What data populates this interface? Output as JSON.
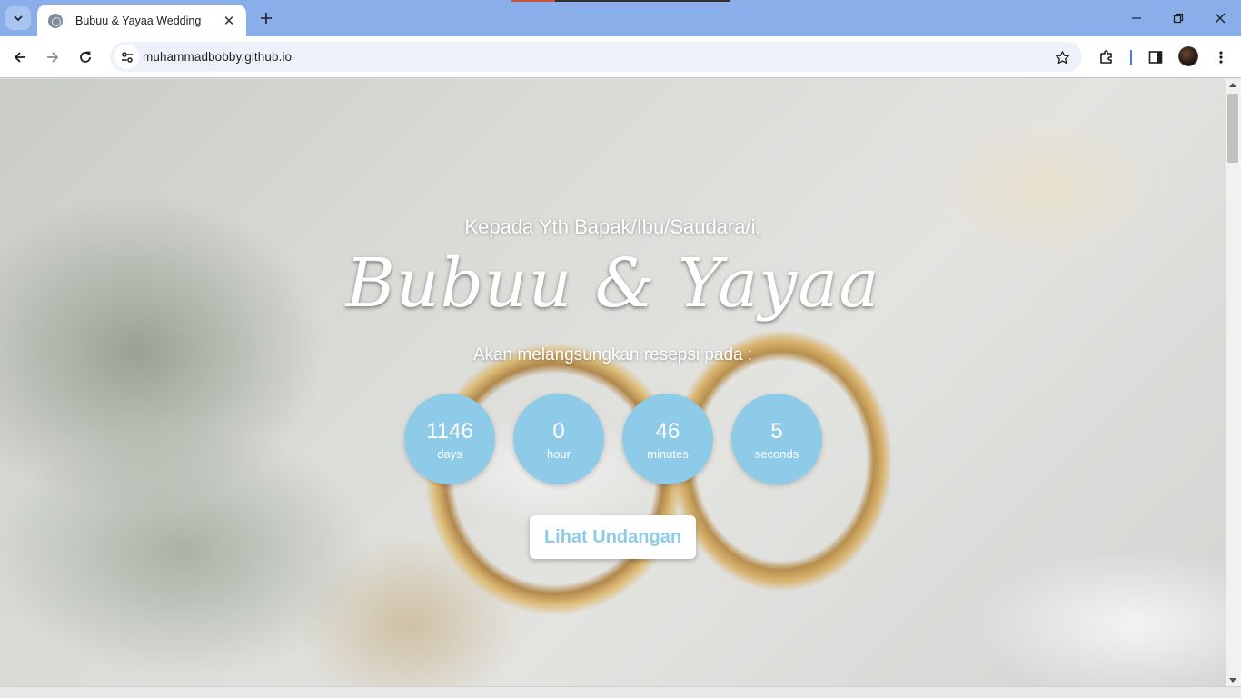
{
  "browser": {
    "tab_title": "Bubuu & Yayaa Wedding",
    "tab_close": "✕",
    "new_tab": "+",
    "url": "muhammadbobby.github.io"
  },
  "page": {
    "greeting": "Kepada Yth Bapak/Ibu/Saudara/i,",
    "couple": "Bubuu & Yayaa",
    "subtitle": "Akan melangsungkan resepsi pada :",
    "countdown": [
      {
        "value": "1146",
        "label": "days"
      },
      {
        "value": "0",
        "label": "hour"
      },
      {
        "value": "46",
        "label": "minutes"
      },
      {
        "value": "5",
        "label": "seconds"
      }
    ],
    "cta_label": "Lihat Undangan"
  },
  "colors": {
    "tabstrip": "#8aaee9",
    "accent": "#8ecbe8",
    "omnibox": "#edf2fa"
  },
  "icons": [
    "tab-search-icon",
    "globe-favicon-icon",
    "close-icon",
    "plus-icon",
    "minimize-icon",
    "restore-icon",
    "close-window-icon",
    "back-arrow-icon",
    "forward-arrow-icon",
    "reload-icon",
    "site-info-icon",
    "star-icon",
    "extensions-icon",
    "side-panel-icon",
    "profile-avatar",
    "more-vert-icon"
  ]
}
